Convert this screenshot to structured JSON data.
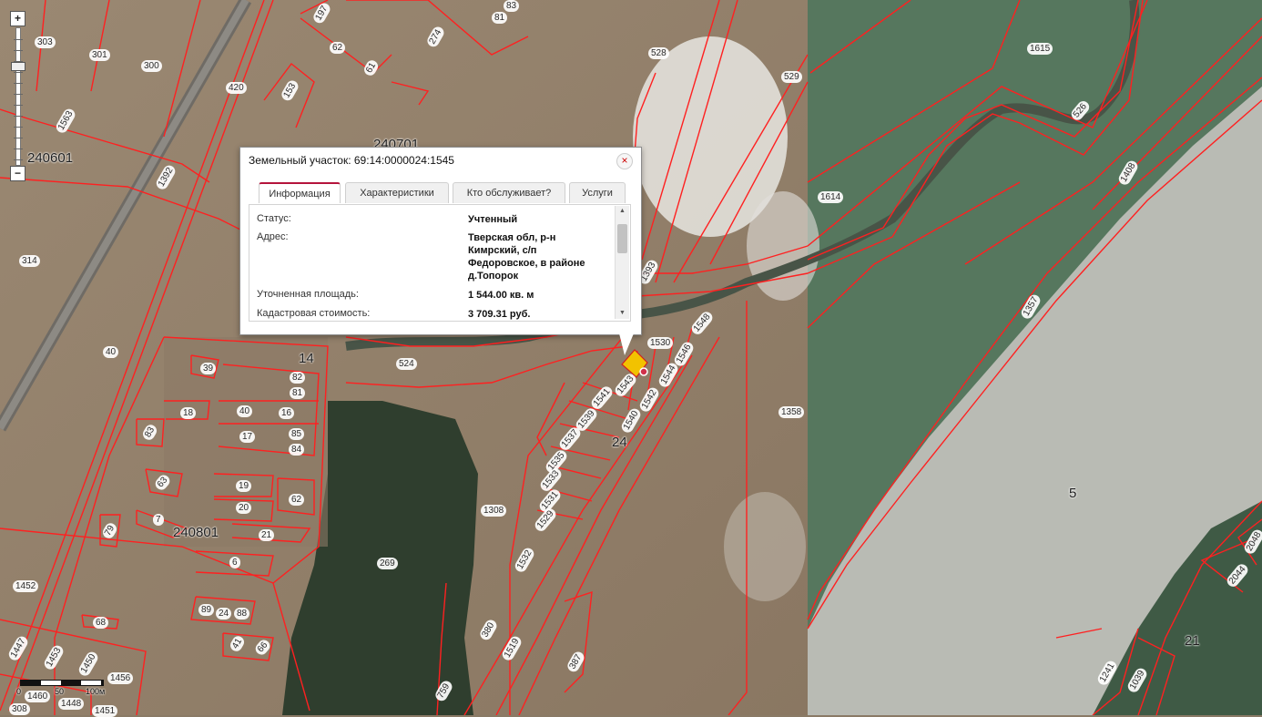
{
  "popup": {
    "title": "Земельный участок: 69:14:0000024:1545",
    "close_symbol": "×",
    "tabs": [
      "Информация",
      "Характеристики",
      "Кто обслуживает?",
      "Услуги"
    ],
    "active_tab": "Информация",
    "rows": [
      {
        "label": "Статус:",
        "value": "Учтенный"
      },
      {
        "label": "Адрес:",
        "value": "Тверская обл, р-н Кимрский, с/п Федоровское, в районе д.Топорок"
      },
      {
        "label": "Уточненная площадь:",
        "value": "1 544.00 кв. м"
      },
      {
        "label": "Кадастровая стоимость:",
        "value": "3 709.31 руб."
      }
    ]
  },
  "zoom": {
    "in_symbol": "+",
    "out_symbol": "−",
    "level_fraction": 0.72
  },
  "scale": {
    "labels": [
      "0",
      "50",
      "100м"
    ]
  },
  "blocks": {
    "b240601": "240601",
    "b240701": "240701",
    "b240801": "240801",
    "b14": "14",
    "b24": "24",
    "b5": "5",
    "b21": "21"
  },
  "parcels": {
    "p303": "303",
    "p301": "301",
    "p300": "300",
    "p420": "420",
    "p1563": "1563",
    "p197": "197",
    "p62a": "62",
    "p61": "61",
    "p153": "153",
    "p274": "274",
    "p81a": "81",
    "p83": "83",
    "p528": "528",
    "p529": "529",
    "p1615": "1615",
    "p526": "526",
    "p1614": "1614",
    "p1408": "1408",
    "p1392": "1392",
    "p314": "314",
    "p40a": "40",
    "p524": "524",
    "p1393": "1393",
    "p1548": "1548",
    "p1530": "1530",
    "p1546": "1546",
    "p1544": "1544",
    "p1543": "1543",
    "p1542": "1542",
    "p1541": "1541",
    "p1539": "1539",
    "p1540": "1540",
    "p1537": "1537",
    "p1535": "1535",
    "p1533": "1533",
    "p1531": "1531",
    "p1529": "1529",
    "p1358": "1358",
    "p1357": "1357",
    "p39": "39",
    "p82": "82",
    "p81b": "81",
    "p18": "18",
    "p40b": "40",
    "p16": "16",
    "p85": "85",
    "p84": "84",
    "p83b": "83",
    "p17": "17",
    "p63": "63",
    "p19": "19",
    "p62b": "62",
    "p20": "20",
    "p7": "7",
    "p79": "79",
    "p21": "21",
    "p6": "6",
    "p1308": "1308",
    "p269": "269",
    "p1532": "1532",
    "p1452": "1452",
    "p89": "89",
    "p24": "24",
    "p88": "88",
    "p68": "68",
    "p41": "41",
    "p66": "66",
    "p380": "380",
    "p1519": "1519",
    "p387": "387",
    "p759": "759",
    "p1447": "1447",
    "p1453": "1453",
    "p1450": "1450",
    "p1456": "1456",
    "p1460": "1460",
    "p1448": "1448",
    "p1451": "1451",
    "p308": "308",
    "p2048": "2048",
    "p2044": "2044",
    "p1241": "1241",
    "p1039": "1039"
  },
  "colors": {
    "boundary": "#ff2020",
    "active_tab": "#b5143c",
    "marker": "#f2c200"
  }
}
